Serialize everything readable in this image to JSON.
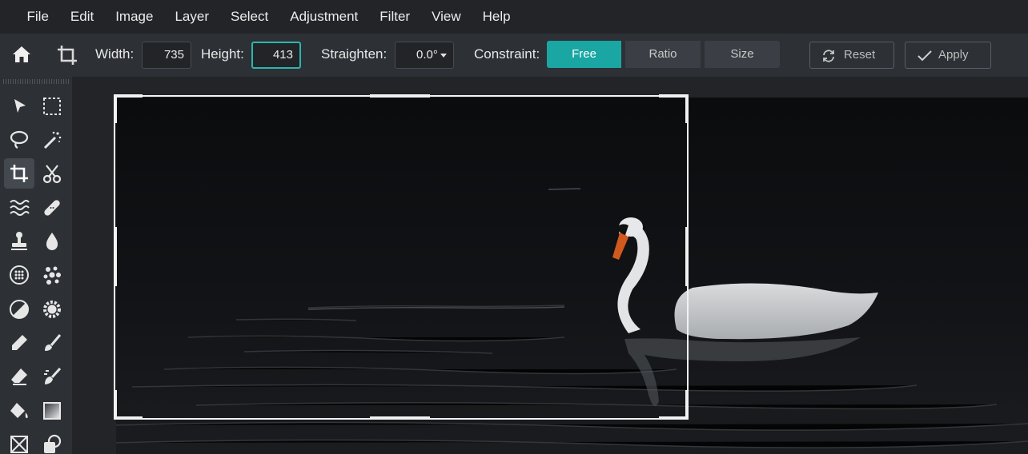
{
  "menu": [
    "File",
    "Edit",
    "Image",
    "Layer",
    "Select",
    "Adjustment",
    "Filter",
    "View",
    "Help"
  ],
  "toolbar": {
    "width_label": "Width:",
    "width_value": "735",
    "height_label": "Height:",
    "height_value": "413",
    "straighten_label": "Straighten:",
    "straighten_value": "0.0°",
    "constraint_label": "Constraint:",
    "constraint_options": [
      "Free",
      "Ratio",
      "Size"
    ],
    "constraint_selected": "Free",
    "reset_label": "Reset",
    "apply_label": "Apply"
  },
  "tools": [
    [
      "move-tool-icon",
      "marquee-select-icon"
    ],
    [
      "lasso-icon",
      "magic-wand-icon"
    ],
    [
      "crop-icon",
      "scissors-icon"
    ],
    [
      "liquify-waves-icon",
      "healing-bandage-icon"
    ],
    [
      "clone-stamp-icon",
      "blur-drop-icon"
    ],
    [
      "sponge-dots-icon",
      "scatter-brush-icon"
    ],
    [
      "dodge-burn-icon",
      "sharpen-gear-icon"
    ],
    [
      "pen-icon",
      "brush-icon"
    ],
    [
      "eraser-icon",
      "smudge-icon"
    ],
    [
      "paint-bucket-icon",
      "gradient-icon"
    ],
    [
      "frame-icon",
      "shape-icon"
    ]
  ],
  "selected_tool": "crop-icon",
  "colors": {
    "accent": "#1aa6a2",
    "menubar": "#222428",
    "panel": "#2d3035"
  }
}
